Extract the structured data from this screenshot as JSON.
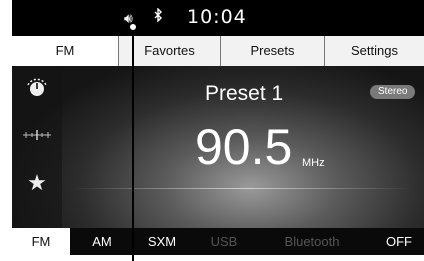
{
  "status": {
    "time": "10:04"
  },
  "tabs": [
    {
      "label": "FM"
    },
    {
      "label": "Favortes"
    },
    {
      "label": "Presets"
    },
    {
      "label": "Settings"
    }
  ],
  "station": {
    "preset_name": "Preset 1",
    "frequency": "90.5",
    "unit": "MHz",
    "stereo_badge": "Stereo"
  },
  "bottom_tabs": [
    {
      "label": "FM"
    },
    {
      "label": "AM"
    },
    {
      "label": "SXM"
    },
    {
      "label": "USB"
    },
    {
      "label": "Bluetooth"
    },
    {
      "label": "OFF"
    }
  ],
  "icons": {
    "status": [
      "speaker-icon",
      "bluetooth-icon"
    ],
    "side": [
      "tuner-dial-icon",
      "signal-scale-icon",
      "star-icon"
    ]
  },
  "colors": {
    "screen_bg": "#000000",
    "active_tab": "#ffffff",
    "inactive_tab": "#f2f2f2",
    "disabled_source": "#555555",
    "stereo_badge": "#7a7a7a"
  }
}
